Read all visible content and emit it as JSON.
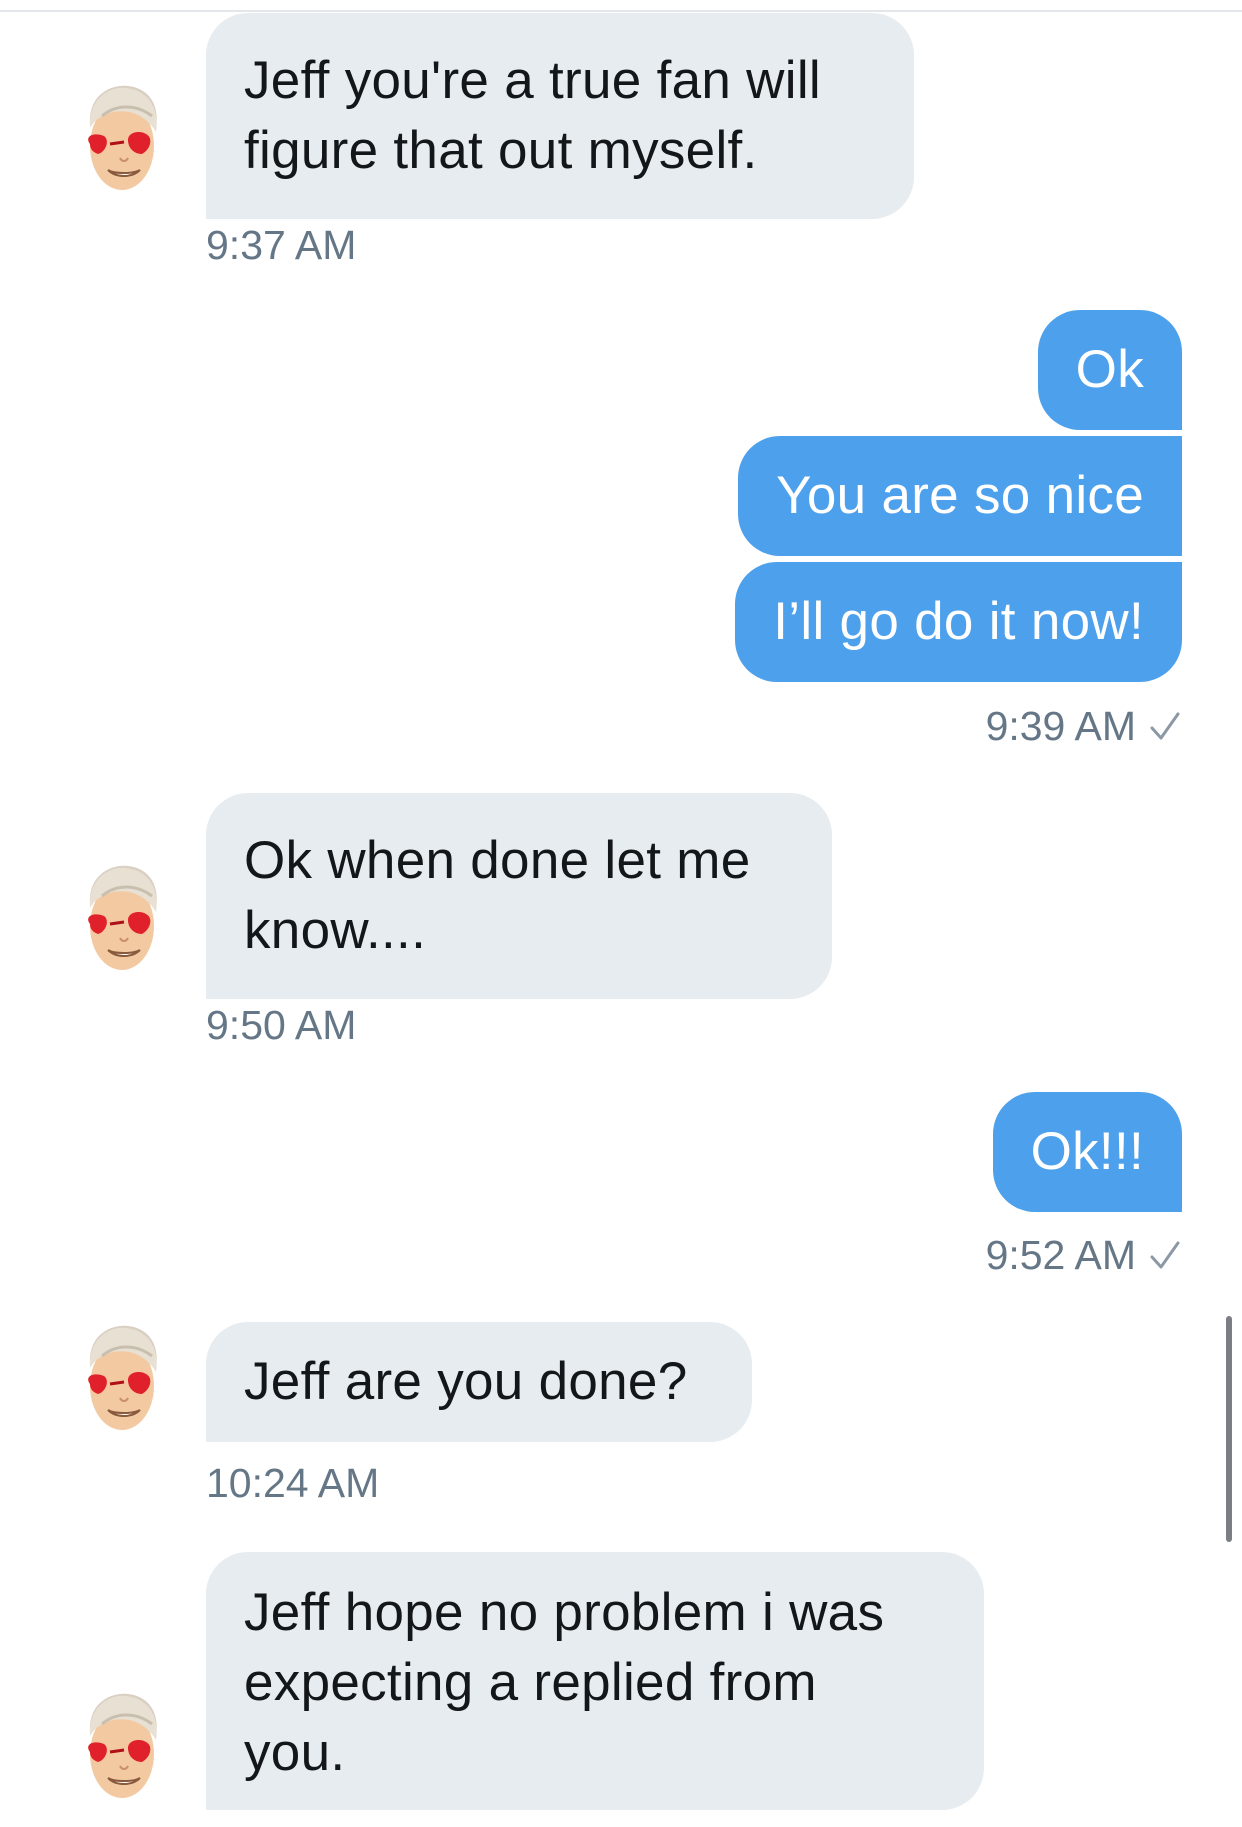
{
  "conversation": {
    "messages": [
      {
        "side": "received",
        "text": [
          "Jeff you're a true fan will",
          "figure that out myself."
        ],
        "time": "9:37 AM"
      },
      {
        "side": "sent",
        "text": "Ok"
      },
      {
        "side": "sent",
        "text": "You are so nice"
      },
      {
        "side": "sent",
        "text": "I’ll go do it now!",
        "time": "9:39 AM",
        "status": "sent-check"
      },
      {
        "side": "received",
        "text": [
          "Ok when done let me",
          "know...."
        ],
        "time": "9:50 AM"
      },
      {
        "side": "sent",
        "text": "Ok!!!",
        "time": "9:52 AM",
        "status": "sent-check"
      },
      {
        "side": "received",
        "text": [
          "Jeff are you done?"
        ],
        "time": "10:24 AM"
      },
      {
        "side": "received",
        "text": [
          "Jeff hope no problem i was",
          "expecting a replied from",
          "you."
        ]
      }
    ]
  },
  "icons": {
    "avatar": "cartoon-face-heart-eyes-avatar",
    "check": "checkmark-icon"
  },
  "colors": {
    "sent_bubble": "#4da0ec",
    "received_bubble": "#e6ecf0",
    "timestamp": "#657786",
    "text_dark": "#14171a"
  }
}
